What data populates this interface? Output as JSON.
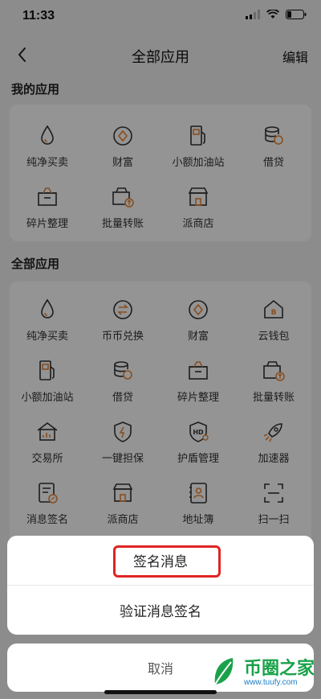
{
  "status": {
    "time": "11:33"
  },
  "nav": {
    "title": "全部应用",
    "edit_label": "编辑"
  },
  "my_apps": {
    "title": "我的应用",
    "items": [
      {
        "label": "纯净买卖",
        "icon": "drop-icon"
      },
      {
        "label": "财富",
        "icon": "diamond-coin-icon"
      },
      {
        "label": "小额加油站",
        "icon": "fuel-pump-icon"
      },
      {
        "label": "借贷",
        "icon": "coin-stack-icon"
      },
      {
        "label": "碎片整理",
        "icon": "box-icon"
      },
      {
        "label": "批量转账",
        "icon": "batch-transfer-icon"
      },
      {
        "label": "派商店",
        "icon": "shop-icon"
      }
    ]
  },
  "all_apps": {
    "title": "全部应用",
    "items": [
      {
        "label": "纯净买卖",
        "icon": "drop-icon"
      },
      {
        "label": "币币兑换",
        "icon": "exchange-icon"
      },
      {
        "label": "财富",
        "icon": "diamond-coin-icon"
      },
      {
        "label": "云钱包",
        "icon": "cloud-wallet-icon"
      },
      {
        "label": "小额加油站",
        "icon": "fuel-pump-icon"
      },
      {
        "label": "借贷",
        "icon": "coin-stack-icon"
      },
      {
        "label": "碎片整理",
        "icon": "box-icon"
      },
      {
        "label": "批量转账",
        "icon": "batch-transfer-icon"
      },
      {
        "label": "交易所",
        "icon": "exchange-house-icon"
      },
      {
        "label": "一键担保",
        "icon": "shield-bolt-icon"
      },
      {
        "label": "护盾管理",
        "icon": "hd-shield-icon"
      },
      {
        "label": "加速器",
        "icon": "rocket-icon"
      },
      {
        "label": "消息签名",
        "icon": "message-sign-icon"
      },
      {
        "label": "派商店",
        "icon": "shop-icon"
      },
      {
        "label": "地址簿",
        "icon": "address-book-icon"
      },
      {
        "label": "扫一扫",
        "icon": "scan-icon"
      }
    ]
  },
  "action_sheet": {
    "options": [
      "签名消息",
      "验证消息签名"
    ],
    "cancel_label": "取消"
  },
  "watermark": {
    "title": "币圈之家",
    "url": "www.tuufy.com"
  },
  "colors": {
    "accent": "#e8873a",
    "highlight": "#e02424",
    "watermark_green": "#1aa14a"
  }
}
